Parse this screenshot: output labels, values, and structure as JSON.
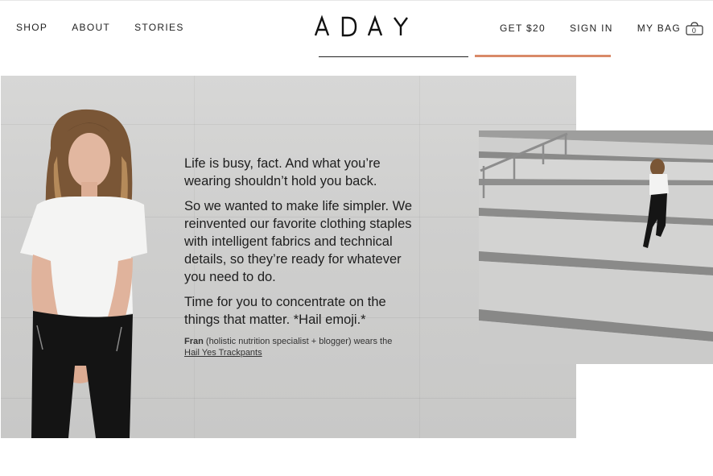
{
  "header": {
    "nav_left": [
      "SHOP",
      "ABOUT",
      "STORIES"
    ],
    "logo": "ADAY",
    "get_offer": "GET $20",
    "sign_in": "SIGN IN",
    "bag_label": "MY BAG",
    "bag_count": "0"
  },
  "hero": {
    "paragraphs": [
      "Life is busy, fact. And what you’re wearing shouldn’t hold you back.",
      "So we wanted to make life simpler. We reinvented our favorite clothing staples with intelligent fabrics and technical details, so they’re ready for whatever you need to do.",
      "Time for you to concentrate on the things that matter. *Hail emoji.*"
    ],
    "credit_name": "Fran",
    "credit_text": " (holistic nutrition specialist + blogger) wears the",
    "credit_link": "Hail Yes Trackpants"
  },
  "colors": {
    "accent": "#d98a68",
    "text": "#222222",
    "wall": "#cfcfce"
  },
  "icons": [
    "bag-icon"
  ]
}
